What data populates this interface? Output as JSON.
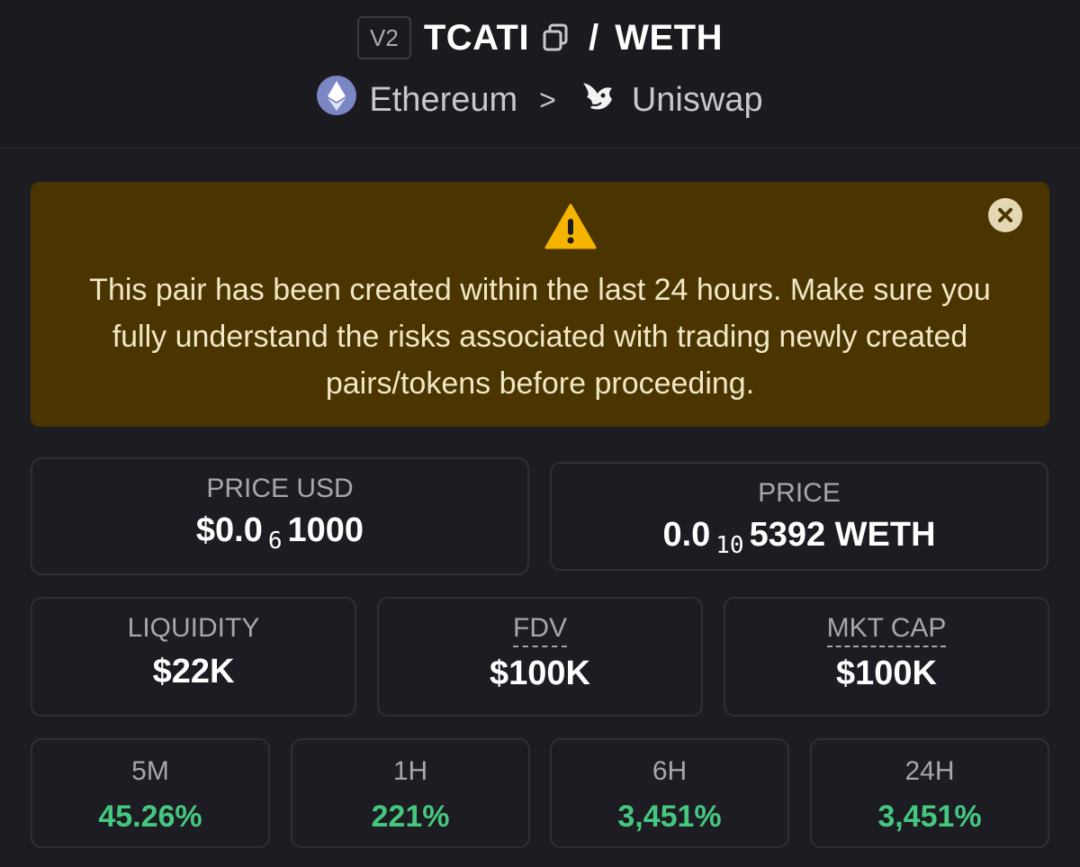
{
  "header": {
    "version": "V2",
    "base_token": "TCATI",
    "separator": "/",
    "quote_token": "WETH",
    "chain": "Ethereum",
    "chevron": ">",
    "dex": "Uniswap"
  },
  "warning": {
    "message": "This pair has been created within the last 24 hours. Make sure you fully understand the risks associated with trading newly created pairs/tokens before proceeding.",
    "accent_color": "#4a3500"
  },
  "price_usd": {
    "label": "PRICE USD",
    "prefix": "$0.0",
    "zeros": "6",
    "suffix": "1000"
  },
  "price": {
    "label": "PRICE",
    "prefix": "0.0",
    "zeros": "10",
    "suffix": "5392 WETH"
  },
  "stats": {
    "liquidity": {
      "label": "LIQUIDITY",
      "value": "$22K"
    },
    "fdv": {
      "label": "FDV",
      "value": "$100K"
    },
    "mkt_cap": {
      "label": "MKT CAP",
      "value": "$100K"
    }
  },
  "changes": [
    {
      "label": "5M",
      "value": "45.26%"
    },
    {
      "label": "1H",
      "value": "221%"
    },
    {
      "label": "6H",
      "value": "3,451%"
    },
    {
      "label": "24H",
      "value": "3,451%"
    }
  ],
  "colors": {
    "positive": "#46c77f",
    "background": "#1c1c22"
  }
}
